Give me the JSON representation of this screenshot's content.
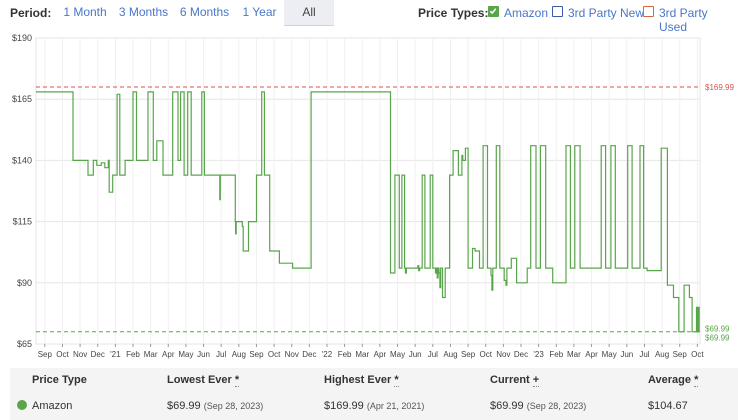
{
  "toolbar": {
    "period_label": "Period:",
    "periods": [
      "1 Month",
      "3 Months",
      "6 Months",
      "1 Year",
      "All"
    ],
    "active_period": "All",
    "price_types_label": "Price Types:",
    "price_types": [
      {
        "label": "Amazon",
        "checked": true,
        "color": "#59a54b"
      },
      {
        "label": "3rd Party New",
        "checked": false,
        "color": "#3d5aa8"
      },
      {
        "label": "3rd Party Used",
        "checked": false,
        "color": "#d5693d"
      }
    ]
  },
  "chart_data": {
    "type": "line",
    "title": "",
    "xlabel": "",
    "ylabel": "",
    "ylim": [
      65,
      190
    ],
    "y_ticks": [
      65,
      90,
      115,
      140,
      165,
      190
    ],
    "y_tick_labels": [
      "$65",
      "$90",
      "$115",
      "$140",
      "$165",
      "$190"
    ],
    "x_tick_labels": [
      "Sep",
      "Oct",
      "Nov",
      "Dec",
      "'21",
      "Feb",
      "Mar",
      "Apr",
      "May",
      "Jun",
      "Jul",
      "Aug",
      "Sep",
      "Oct",
      "Nov",
      "Dec",
      "'22",
      "Feb",
      "Mar",
      "Apr",
      "May",
      "Jun",
      "Jul",
      "Aug",
      "Sep",
      "Oct",
      "Nov",
      "Dec",
      "'23",
      "Feb",
      "Mar",
      "Apr",
      "May",
      "Jun",
      "Jul",
      "Aug",
      "Sep",
      "Oct"
    ],
    "grid": true,
    "series": [
      {
        "name": "Amazon",
        "color": "#59a54b",
        "step": true,
        "points": [
          [
            0.0,
            168
          ],
          [
            2.0,
            168
          ],
          [
            2.1,
            140
          ],
          [
            2.9,
            140
          ],
          [
            2.95,
            134
          ],
          [
            3.2,
            134
          ],
          [
            3.25,
            140
          ],
          [
            3.45,
            138
          ],
          [
            3.7,
            139
          ],
          [
            3.9,
            137
          ],
          [
            4.1,
            140
          ],
          [
            4.15,
            127
          ],
          [
            4.3,
            127
          ],
          [
            4.35,
            134
          ],
          [
            4.6,
            134
          ],
          [
            4.6,
            167
          ],
          [
            4.7,
            167
          ],
          [
            4.75,
            134
          ],
          [
            5.0,
            134
          ],
          [
            5.05,
            140
          ],
          [
            5.5,
            140
          ],
          [
            5.5,
            168
          ],
          [
            5.65,
            168
          ],
          [
            5.7,
            140
          ],
          [
            6.3,
            140
          ],
          [
            6.35,
            168
          ],
          [
            6.6,
            168
          ],
          [
            6.65,
            140
          ],
          [
            6.85,
            140
          ],
          [
            6.85,
            148
          ],
          [
            7.2,
            148
          ],
          [
            7.2,
            134
          ],
          [
            7.7,
            134
          ],
          [
            7.75,
            168
          ],
          [
            8.0,
            168
          ],
          [
            8.05,
            140
          ],
          [
            8.2,
            140
          ],
          [
            8.2,
            168
          ],
          [
            8.35,
            168
          ],
          [
            8.4,
            134
          ],
          [
            8.6,
            134
          ],
          [
            8.6,
            168
          ],
          [
            8.75,
            168
          ],
          [
            8.8,
            134
          ],
          [
            9.4,
            134
          ],
          [
            9.4,
            168
          ],
          [
            9.5,
            168
          ],
          [
            9.55,
            134
          ],
          [
            10.4,
            134
          ],
          [
            10.42,
            124
          ],
          [
            10.45,
            134
          ],
          [
            11.3,
            134
          ],
          [
            11.3,
            115
          ],
          [
            11.32,
            110
          ],
          [
            11.35,
            115
          ],
          [
            11.65,
            115
          ],
          [
            11.7,
            113
          ],
          [
            11.75,
            103
          ],
          [
            12.0,
            103
          ],
          [
            12.05,
            115
          ],
          [
            12.5,
            115
          ],
          [
            12.5,
            134
          ],
          [
            12.75,
            134
          ],
          [
            12.8,
            168
          ],
          [
            12.9,
            168
          ],
          [
            12.95,
            134
          ],
          [
            13.2,
            134
          ],
          [
            13.25,
            103
          ],
          [
            13.7,
            103
          ],
          [
            13.8,
            98
          ],
          [
            14.5,
            98
          ],
          [
            14.55,
            96
          ],
          [
            15.6,
            96
          ],
          [
            15.6,
            168
          ],
          [
            20.0,
            168
          ],
          [
            20.1,
            94
          ],
          [
            20.3,
            94
          ],
          [
            20.35,
            134
          ],
          [
            20.55,
            134
          ],
          [
            20.6,
            96
          ],
          [
            20.7,
            96
          ],
          [
            20.75,
            134
          ],
          [
            20.85,
            134
          ],
          [
            20.9,
            96
          ],
          [
            20.95,
            94
          ],
          [
            21.0,
            96
          ],
          [
            21.6,
            96
          ],
          [
            21.65,
            97
          ],
          [
            21.7,
            95
          ],
          [
            21.75,
            96
          ],
          [
            21.85,
            96
          ],
          [
            21.9,
            134
          ],
          [
            22.0,
            134
          ],
          [
            22.05,
            96
          ],
          [
            22.3,
            96
          ],
          [
            22.35,
            134
          ],
          [
            22.45,
            134
          ],
          [
            22.5,
            96
          ],
          [
            22.6,
            96
          ],
          [
            22.65,
            94
          ],
          [
            22.7,
            96
          ],
          [
            22.75,
            92
          ],
          [
            22.8,
            96
          ],
          [
            22.85,
            94
          ],
          [
            22.9,
            88
          ],
          [
            22.95,
            96
          ],
          [
            23.0,
            96
          ],
          [
            23.05,
            84
          ],
          [
            23.15,
            84
          ],
          [
            23.2,
            96
          ],
          [
            23.4,
            96
          ],
          [
            23.45,
            134
          ],
          [
            23.6,
            134
          ],
          [
            23.65,
            144
          ],
          [
            23.9,
            144
          ],
          [
            23.95,
            134
          ],
          [
            24.1,
            134
          ],
          [
            24.15,
            142
          ],
          [
            24.2,
            140
          ],
          [
            24.3,
            140
          ],
          [
            24.35,
            145
          ],
          [
            24.45,
            145
          ],
          [
            24.5,
            96
          ],
          [
            24.7,
            96
          ],
          [
            24.75,
            104
          ],
          [
            24.85,
            104
          ],
          [
            24.9,
            103
          ],
          [
            25.1,
            103
          ],
          [
            25.15,
            96
          ],
          [
            25.3,
            96
          ],
          [
            25.35,
            146
          ],
          [
            25.55,
            146
          ],
          [
            25.6,
            96
          ],
          [
            25.75,
            96
          ],
          [
            25.8,
            93
          ],
          [
            25.85,
            87
          ],
          [
            25.9,
            96
          ],
          [
            26.05,
            96
          ],
          [
            26.1,
            146
          ],
          [
            26.25,
            146
          ],
          [
            26.3,
            96
          ],
          [
            26.5,
            96
          ],
          [
            26.55,
            91
          ],
          [
            26.65,
            89
          ],
          [
            26.7,
            96
          ],
          [
            26.9,
            96
          ],
          [
            26.95,
            100
          ],
          [
            27.2,
            100
          ],
          [
            27.25,
            90
          ],
          [
            27.8,
            90
          ],
          [
            27.85,
            96
          ],
          [
            28.0,
            96
          ],
          [
            28.05,
            146
          ],
          [
            28.3,
            146
          ],
          [
            28.35,
            96
          ],
          [
            28.55,
            96
          ],
          [
            28.6,
            146
          ],
          [
            28.85,
            146
          ],
          [
            28.9,
            96
          ],
          [
            29.25,
            96
          ],
          [
            29.3,
            90
          ],
          [
            30.0,
            90
          ],
          [
            30.05,
            146
          ],
          [
            30.25,
            146
          ],
          [
            30.3,
            96
          ],
          [
            30.5,
            96
          ],
          [
            30.55,
            146
          ],
          [
            30.8,
            146
          ],
          [
            30.85,
            96
          ],
          [
            32.0,
            96
          ],
          [
            32.05,
            146
          ],
          [
            32.25,
            146
          ],
          [
            32.3,
            96
          ],
          [
            32.55,
            96
          ],
          [
            32.6,
            146
          ],
          [
            32.8,
            146
          ],
          [
            32.85,
            96
          ],
          [
            33.5,
            96
          ],
          [
            33.55,
            146
          ],
          [
            33.75,
            146
          ],
          [
            33.8,
            96
          ],
          [
            34.2,
            96
          ],
          [
            34.25,
            146
          ],
          [
            34.4,
            146
          ],
          [
            34.45,
            96
          ],
          [
            34.6,
            96
          ],
          [
            34.65,
            95
          ],
          [
            35.4,
            95
          ],
          [
            35.45,
            145
          ],
          [
            35.75,
            145
          ],
          [
            35.8,
            89
          ],
          [
            36.1,
            89
          ],
          [
            36.15,
            84
          ],
          [
            36.4,
            84
          ],
          [
            36.45,
            70
          ],
          [
            36.7,
            70
          ],
          [
            36.75,
            89
          ],
          [
            37.0,
            89
          ],
          [
            37.05,
            84
          ],
          [
            37.15,
            84
          ],
          [
            37.2,
            70
          ],
          [
            37.4,
            70
          ],
          [
            37.45,
            80
          ],
          [
            37.5,
            70
          ],
          [
            37.55,
            80
          ],
          [
            37.6,
            70
          ],
          [
            37.65,
            70
          ]
        ]
      }
    ],
    "reference_lines": [
      {
        "value": 169.99,
        "label": "$169.99",
        "color": "#d9534f"
      },
      {
        "value": 69.99,
        "label": "$69.99",
        "color": "#59a54b"
      }
    ],
    "end_labels": [
      "$69.99",
      "$69.99"
    ]
  },
  "table": {
    "headers": {
      "price_type": "Price Type",
      "lowest": "Lowest Ever",
      "highest": "Highest Ever",
      "current": "Current",
      "average": "Average"
    },
    "header_markers": {
      "lowest": "*",
      "highest": "*",
      "current": "+",
      "average": "*"
    },
    "row": {
      "price_type": "Amazon",
      "lowest_value": "$69.99",
      "lowest_date": "(Sep 28, 2023)",
      "highest_value": "$169.99",
      "highest_date": "(Apr 21, 2021)",
      "current_value": "$69.99",
      "current_date": "(Sep 28, 2023)",
      "average": "$104.67",
      "dot_color": "#59a54b"
    }
  }
}
